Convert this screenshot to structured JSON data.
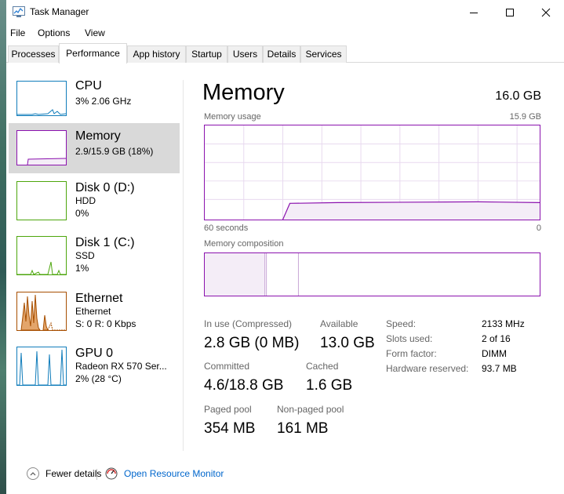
{
  "window": {
    "title": "Task Manager"
  },
  "menu": [
    "File",
    "Options",
    "View"
  ],
  "tabs": [
    "Processes",
    "Performance",
    "App history",
    "Startup",
    "Users",
    "Details",
    "Services"
  ],
  "resources": [
    {
      "name": "CPU",
      "line1": "3%  2.06 GHz",
      "color": "#117dbb"
    },
    {
      "name": "Memory",
      "line1": "2.9/15.9 GB (18%)",
      "color": "#8b12ae"
    },
    {
      "name": "Disk 0 (D:)",
      "line1": "HDD",
      "line2": "0%",
      "color": "#4da60c"
    },
    {
      "name": "Disk 1 (C:)",
      "line1": "SSD",
      "line2": "1%",
      "color": "#4da60c"
    },
    {
      "name": "Ethernet",
      "line1": "Ethernet",
      "line2": "S: 0  R: 0 Kbps",
      "color": "#a74f01"
    },
    {
      "name": "GPU 0",
      "line1": "Radeon RX 570 Ser...",
      "line2": "2%  (28 °C)",
      "color": "#117dbb"
    }
  ],
  "memory": {
    "title": "Memory",
    "total": "16.0 GB",
    "usage_label": "Memory usage",
    "usage_max": "15.9 GB",
    "axis_left": "60 seconds",
    "axis_right": "0",
    "composition_label": "Memory composition",
    "stats": {
      "in_use_label": "In use (Compressed)",
      "in_use_value": "2.8 GB (0 MB)",
      "available_label": "Available",
      "available_value": "13.0 GB",
      "committed_label": "Committed",
      "committed_value": "4.6/18.8 GB",
      "cached_label": "Cached",
      "cached_value": "1.6 GB",
      "paged_label": "Paged pool",
      "paged_value": "354 MB",
      "nonpaged_label": "Non-paged pool",
      "nonpaged_value": "161 MB"
    },
    "specs": [
      {
        "label": "Speed:",
        "value": "2133 MHz"
      },
      {
        "label": "Slots used:",
        "value": "2 of 16"
      },
      {
        "label": "Form factor:",
        "value": "DIMM"
      },
      {
        "label": "Hardware reserved:",
        "value": "93.7 MB"
      }
    ]
  },
  "footer": {
    "fewer_details": "Fewer details",
    "open_monitor": "Open Resource Monitor"
  },
  "colors": {
    "memory_accent": "#8b12ae",
    "selected_bg": "#d9d9d9"
  }
}
